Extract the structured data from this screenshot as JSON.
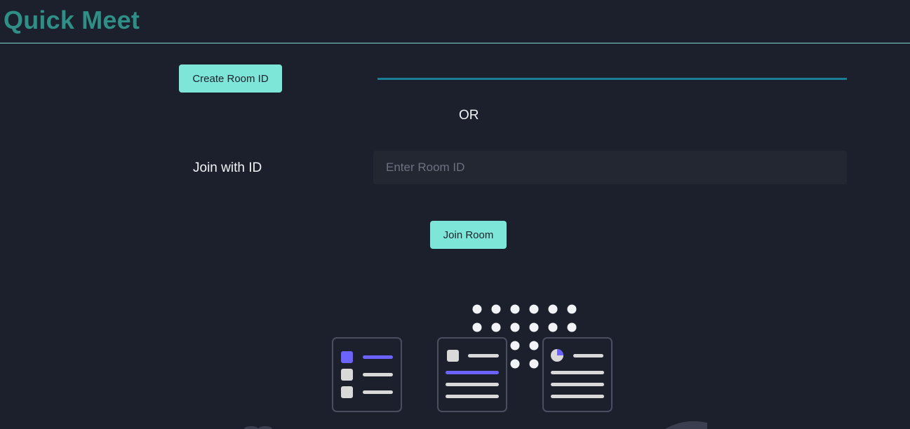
{
  "header": {
    "title": "Quick Meet"
  },
  "create": {
    "button_label": "Create Room ID",
    "generated_id": ""
  },
  "divider": {
    "or_text": "OR"
  },
  "join": {
    "label": "Join with ID",
    "input_value": "",
    "input_placeholder": "Enter Room ID",
    "button_label": "Join Room"
  },
  "colors": {
    "background": "#1b202c",
    "title": "#2f8f87",
    "button": "#7ee6d9",
    "accent_line": "#1a7c95",
    "illustration_accent": "#6c63ff"
  },
  "illustration": {
    "name": "meeting-dashboard-illustration"
  }
}
